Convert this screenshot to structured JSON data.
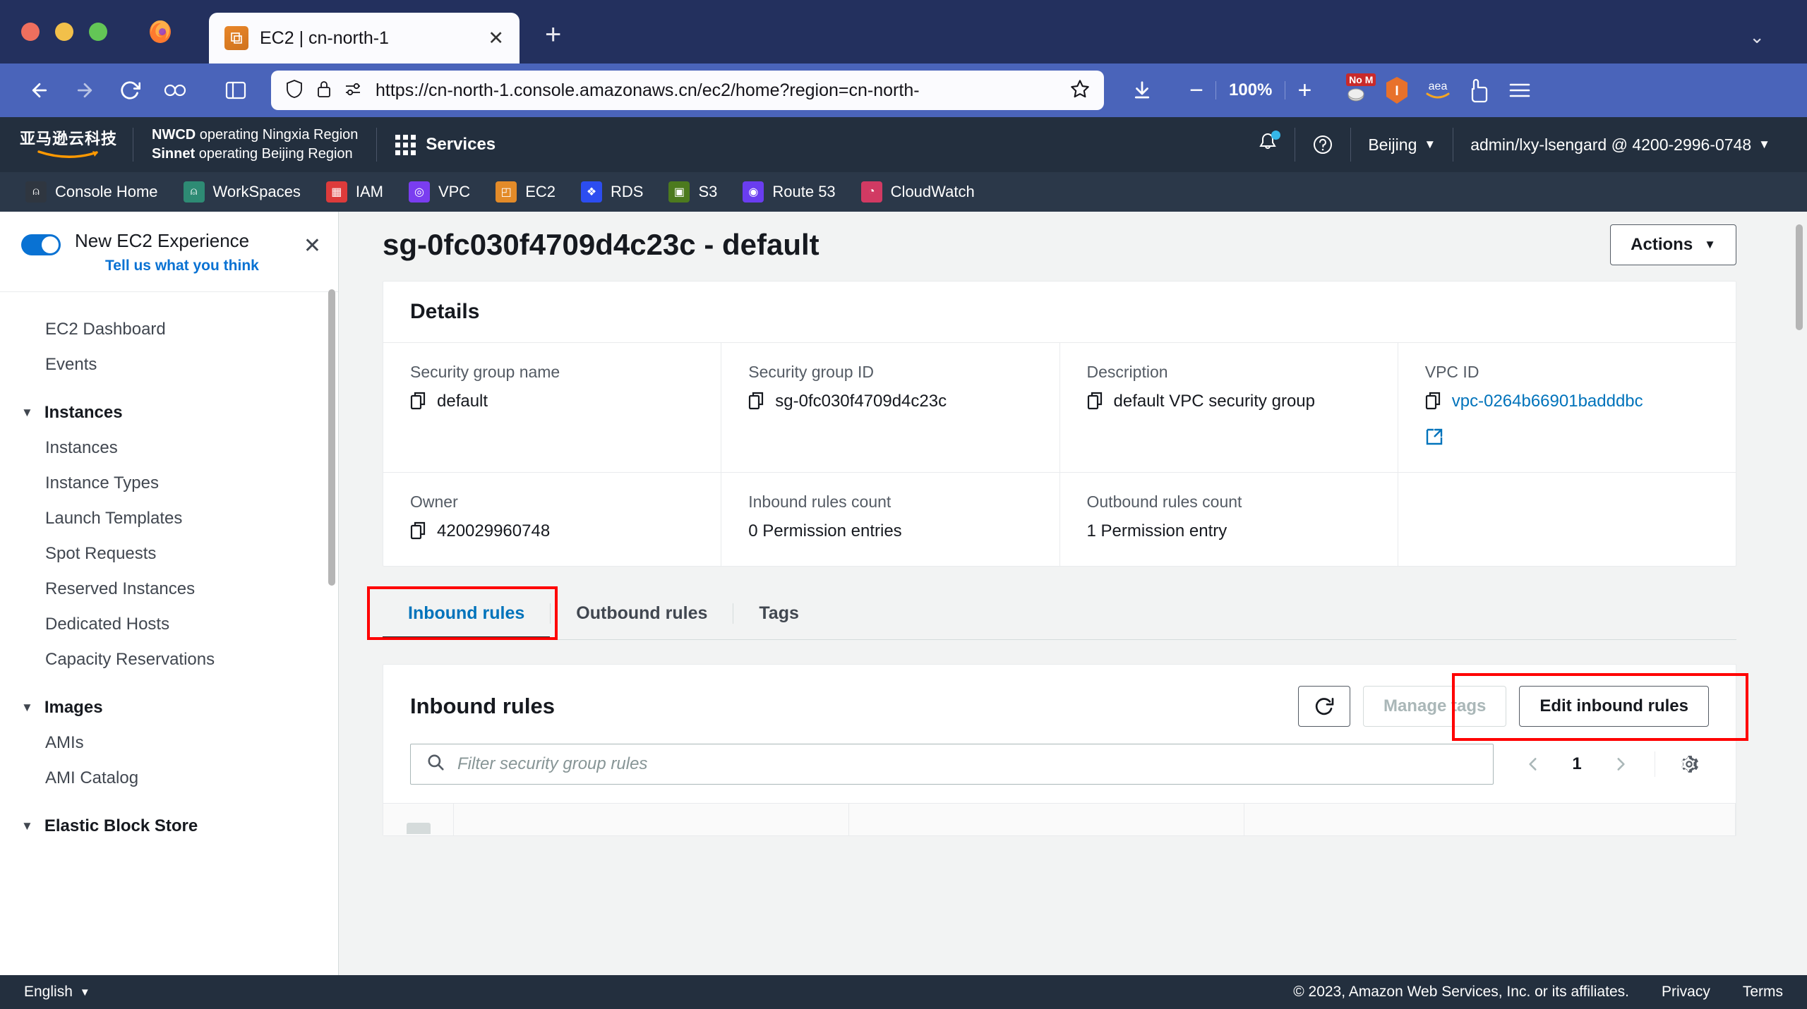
{
  "browser": {
    "tab": {
      "title": "EC2 | cn-north-1",
      "favicon": "ec2-icon",
      "close": "✕"
    },
    "newtab_label": "+",
    "titlebar_chevron": "⌄",
    "url": "https://cn-north-1.console.amazonaws.cn/ec2/home?region=cn-north-",
    "zoom_level": "100%",
    "zoom_out": "−",
    "zoom_in": "+",
    "extensions": [
      {
        "name": "no-script-extension",
        "badge": "No M"
      },
      {
        "name": "bitwarden-extension",
        "glyph": "I"
      },
      {
        "name": "amazon-assistant-extension",
        "glyph": "aea"
      },
      {
        "name": "pocket-extension",
        "glyph": ""
      }
    ]
  },
  "aws_header": {
    "logo_cn": "亚马逊云科技",
    "region_line1_bold": "NWCD",
    "region_line1": " operating Ningxia Region",
    "region_line2_bold": "Sinnet",
    "region_line2": " operating Beijing Region",
    "services_label": "Services",
    "region_selector": "Beijing",
    "account": "admin/lxy-lsengard @ 4200-2996-0748",
    "caret": "▼"
  },
  "service_bar": [
    {
      "label": "Console Home",
      "icon": "console-home-icon",
      "color": "#2f3640",
      "glyph": "⬡"
    },
    {
      "label": "WorkSpaces",
      "icon": "workspaces-icon",
      "color": "#2e8b74",
      "glyph": "⬡"
    },
    {
      "label": "IAM",
      "icon": "iam-icon",
      "color": "#dd3b3b",
      "glyph": "▤"
    },
    {
      "label": "VPC",
      "icon": "vpc-icon",
      "color": "#7a3df0",
      "glyph": "◎"
    },
    {
      "label": "EC2",
      "icon": "ec2-icon",
      "color": "#e38b29",
      "glyph": "◰"
    },
    {
      "label": "RDS",
      "icon": "rds-icon",
      "color": "#2c4df0",
      "glyph": "❖"
    },
    {
      "label": "S3",
      "icon": "s3-icon",
      "color": "#4c7a1e",
      "glyph": "▣"
    },
    {
      "label": "Route 53",
      "icon": "route53-icon",
      "color": "#6a3df0",
      "glyph": "◉"
    },
    {
      "label": "CloudWatch",
      "icon": "cloudwatch-icon",
      "color": "#d13a63",
      "glyph": "◔"
    }
  ],
  "sidebar": {
    "new_experience": {
      "title": "New EC2 Experience",
      "link": "Tell us what you think",
      "close": "✕"
    },
    "items": [
      {
        "label": "EC2 Dashboard",
        "type": "item"
      },
      {
        "label": "Events",
        "type": "item"
      },
      {
        "label": "Instances",
        "type": "group"
      },
      {
        "label": "Instances",
        "type": "item"
      },
      {
        "label": "Instance Types",
        "type": "item"
      },
      {
        "label": "Launch Templates",
        "type": "item"
      },
      {
        "label": "Spot Requests",
        "type": "item"
      },
      {
        "label": "Reserved Instances",
        "type": "item"
      },
      {
        "label": "Dedicated Hosts",
        "type": "item"
      },
      {
        "label": "Capacity Reservations",
        "type": "item"
      },
      {
        "label": "Images",
        "type": "group"
      },
      {
        "label": "AMIs",
        "type": "item"
      },
      {
        "label": "AMI Catalog",
        "type": "item"
      },
      {
        "label": "Elastic Block Store",
        "type": "group"
      }
    ]
  },
  "page": {
    "title": "sg-0fc030f4709d4c23c - default",
    "actions_button": "Actions",
    "actions_caret": "▼"
  },
  "details": {
    "heading": "Details",
    "fields": [
      {
        "label": "Security group name",
        "value": "default",
        "copy": true,
        "link": false
      },
      {
        "label": "Security group ID",
        "value": "sg-0fc030f4709d4c23c",
        "copy": true,
        "link": false
      },
      {
        "label": "Description",
        "value": "default VPC security group",
        "copy": true,
        "link": false
      },
      {
        "label": "VPC ID",
        "value": "vpc-0264b66901badddbc",
        "copy": true,
        "link": true
      },
      {
        "label": "Owner",
        "value": "420029960748",
        "copy": true,
        "link": false
      },
      {
        "label": "Inbound rules count",
        "value": "0 Permission entries",
        "copy": false,
        "link": false
      },
      {
        "label": "Outbound rules count",
        "value": "1 Permission entry",
        "copy": false,
        "link": false
      }
    ]
  },
  "tabs": [
    {
      "label": "Inbound rules",
      "active": true,
      "highlighted": true
    },
    {
      "label": "Outbound rules",
      "active": false,
      "highlighted": false
    },
    {
      "label": "Tags",
      "active": false,
      "highlighted": false
    }
  ],
  "rules_panel": {
    "title": "Inbound rules",
    "refresh_icon": "refresh-icon",
    "manage_tags_button": "Manage tags",
    "manage_tags_disabled": true,
    "edit_button": "Edit inbound rules",
    "edit_highlighted": true,
    "filter_placeholder": "Filter security group rules",
    "page_number": "1",
    "prev_arrow": "‹",
    "next_arrow": "›",
    "settings_icon": "gear-icon"
  },
  "footer": {
    "language": "English",
    "language_caret": "▼",
    "copyright": "© 2023, Amazon Web Services, Inc. or its affiliates.",
    "privacy": "Privacy",
    "terms": "Terms"
  },
  "colors": {
    "accent_blue": "#0073bb",
    "annotation_red": "#ff0000",
    "header_navy": "#232f3e",
    "browser_blue": "#4a64ba"
  }
}
